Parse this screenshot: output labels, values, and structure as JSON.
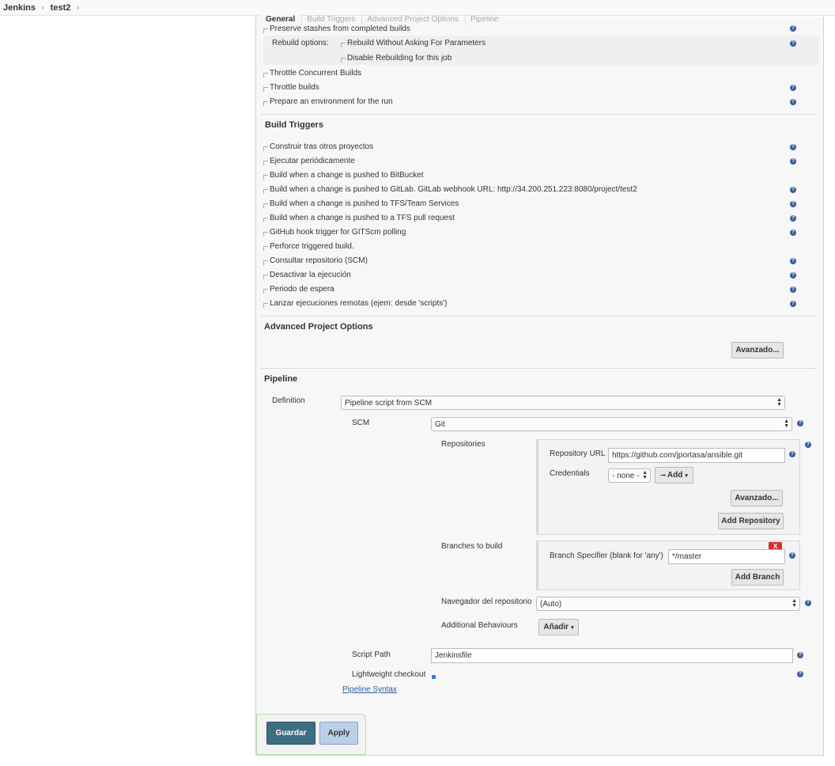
{
  "breadcrumbs": {
    "root": "Jenkins",
    "project": "test2"
  },
  "tabs": [
    "General",
    "Build Triggers",
    "Advanced Project Options",
    "Pipeline"
  ],
  "general": {
    "preserve_stashes": "Preserve stashes from completed builds",
    "rebuild_options_label": "Rebuild options:",
    "rebuild_without_asking": "Rebuild Without Asking For Parameters",
    "disable_rebuilding": "Disable Rebuilding for this job",
    "throttle_concurrent": "Throttle Concurrent Builds",
    "throttle_builds": "Throttle builds",
    "prepare_env": "Prepare an environment for the run"
  },
  "build_triggers": {
    "title": "Build Triggers",
    "items": [
      "Construir tras otros proyectos",
      "Ejecutar periódicamente",
      "Build when a change is pushed to BitBucket",
      "Build when a change is pushed to GitLab. GitLab webhook URL: http://34.200.251.223:8080/project/test2",
      "Build when a change is pushed to TFS/Team Services",
      "Build when a change is pushed to a TFS pull request",
      "GitHub hook trigger for GITScm polling",
      "Perforce triggered build.",
      "Consultar repositorio (SCM)",
      "Desactivar la ejecución",
      "Periodo de espera",
      "Lanzar ejecuciones remotas (ejem: desde 'scripts')"
    ]
  },
  "advanced": {
    "title": "Advanced Project Options",
    "button": "Avanzado..."
  },
  "pipeline": {
    "title": "Pipeline",
    "definition_label": "Definition",
    "definition_value": "Pipeline script from SCM",
    "scm_label": "SCM",
    "scm_value": "Git",
    "repositories_label": "Repositories",
    "repo_url_label": "Repository URL",
    "repo_url_value": "https://github.com/jportasa/ansible.git",
    "credentials_label": "Credentials",
    "credentials_value": "- none -",
    "add_button": "Add",
    "avanzado_button": "Avanzado...",
    "add_repository_button": "Add Repository",
    "branches_label": "Branches to build",
    "branch_spec_label": "Branch Specifier (blank for 'any')",
    "branch_spec_value": "*/master",
    "delete_branch": "X",
    "add_branch_button": "Add Branch",
    "browser_label": "Navegador del repositorio",
    "browser_value": "(Auto)",
    "behaviours_label": "Additional Behaviours",
    "anadir_button": "Añadir",
    "script_path_label": "Script Path",
    "script_path_value": "Jenkinsfile",
    "lightweight_label": "Lightweight checkout",
    "syntax_link": "Pipeline Syntax"
  },
  "footer": {
    "save": "Guardar",
    "apply": "Apply"
  }
}
